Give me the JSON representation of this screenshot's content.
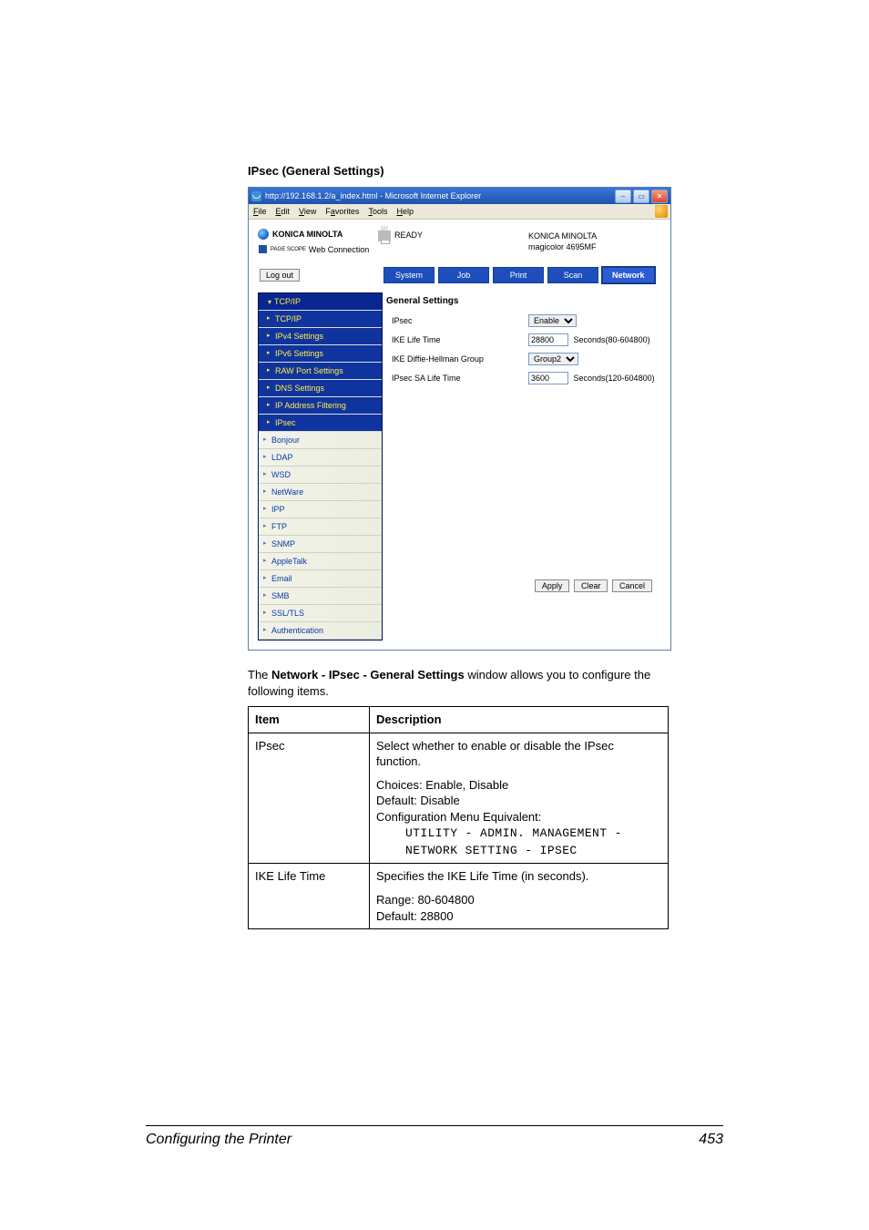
{
  "heading": "IPsec (General Settings)",
  "browser": {
    "title": "http://192.168.1.2/a_index.html - Microsoft Internet Explorer",
    "menu": {
      "file": "File",
      "edit": "Edit",
      "view": "View",
      "favorites": "Favorites",
      "tools": "Tools",
      "help": "Help"
    },
    "brand": {
      "logo": "KONICA MINOLTA",
      "pagescope_prefix": "PAGE SCOPE",
      "pagescope": "Web Connection",
      "ready": "READY",
      "company": "KONICA MINOLTA",
      "model": "magicolor 4695MF"
    },
    "logout": "Log out",
    "tabs": {
      "system": "System",
      "job": "Job",
      "print": "Print",
      "scan": "Scan",
      "network": "Network"
    },
    "sidebar": {
      "tcpip": "TCP/IP",
      "tcpip_sub": "TCP/IP",
      "ipv4": "IPv4 Settings",
      "ipv6": "IPv6 Settings",
      "raw": "RAW Port Settings",
      "dns": "DNS Settings",
      "ipfilter": "IP Address Filtering",
      "ipsec": "IPsec",
      "bonjour": "Bonjour",
      "ldap": "LDAP",
      "wsd": "WSD",
      "netware": "NetWare",
      "ipp": "IPP",
      "ftp": "FTP",
      "snmp": "SNMP",
      "appletalk": "AppleTalk",
      "email": "Email",
      "smb": "SMB",
      "ssltls": "SSL/TLS",
      "auth": "Authentication"
    },
    "panel": {
      "title": "General Settings",
      "rows": {
        "ipsec_label": "IPsec",
        "ipsec_value": "Enable",
        "ike_label": "IKE Life Time",
        "ike_value": "28800",
        "ike_hint": "Seconds(80-604800)",
        "dh_label": "IKE Diffie-Hellman Group",
        "dh_value": "Group2",
        "sa_label": "IPsec SA Life Time",
        "sa_value": "3600",
        "sa_hint": "Seconds(120-604800)"
      },
      "buttons": {
        "apply": "Apply",
        "clear": "Clear",
        "cancel": "Cancel"
      }
    }
  },
  "desc": {
    "line1_pre": "The ",
    "line1_bold": "Network - IPsec - General Settings",
    "line1_post": " window allows you to configure the following items."
  },
  "table": {
    "h_item": "Item",
    "h_desc": "Description",
    "r1_item": "IPsec",
    "r1_l1": "Select whether to enable or disable the IPsec function.",
    "r1_l2": "Choices: Enable, Disable",
    "r1_l3": "Default: Disable",
    "r1_l4": "Configuration Menu Equivalent:",
    "r1_m1": "UTILITY - ADMIN. MANAGEMENT -",
    "r1_m2": "NETWORK SETTING - IPSEC",
    "r2_item": "IKE Life Time",
    "r2_l1": "Specifies the IKE Life Time (in seconds).",
    "r2_l2": "Range: 80-604800",
    "r2_l3": "Default: 28800"
  },
  "footer": {
    "left": "Configuring the Printer",
    "page": "453"
  }
}
